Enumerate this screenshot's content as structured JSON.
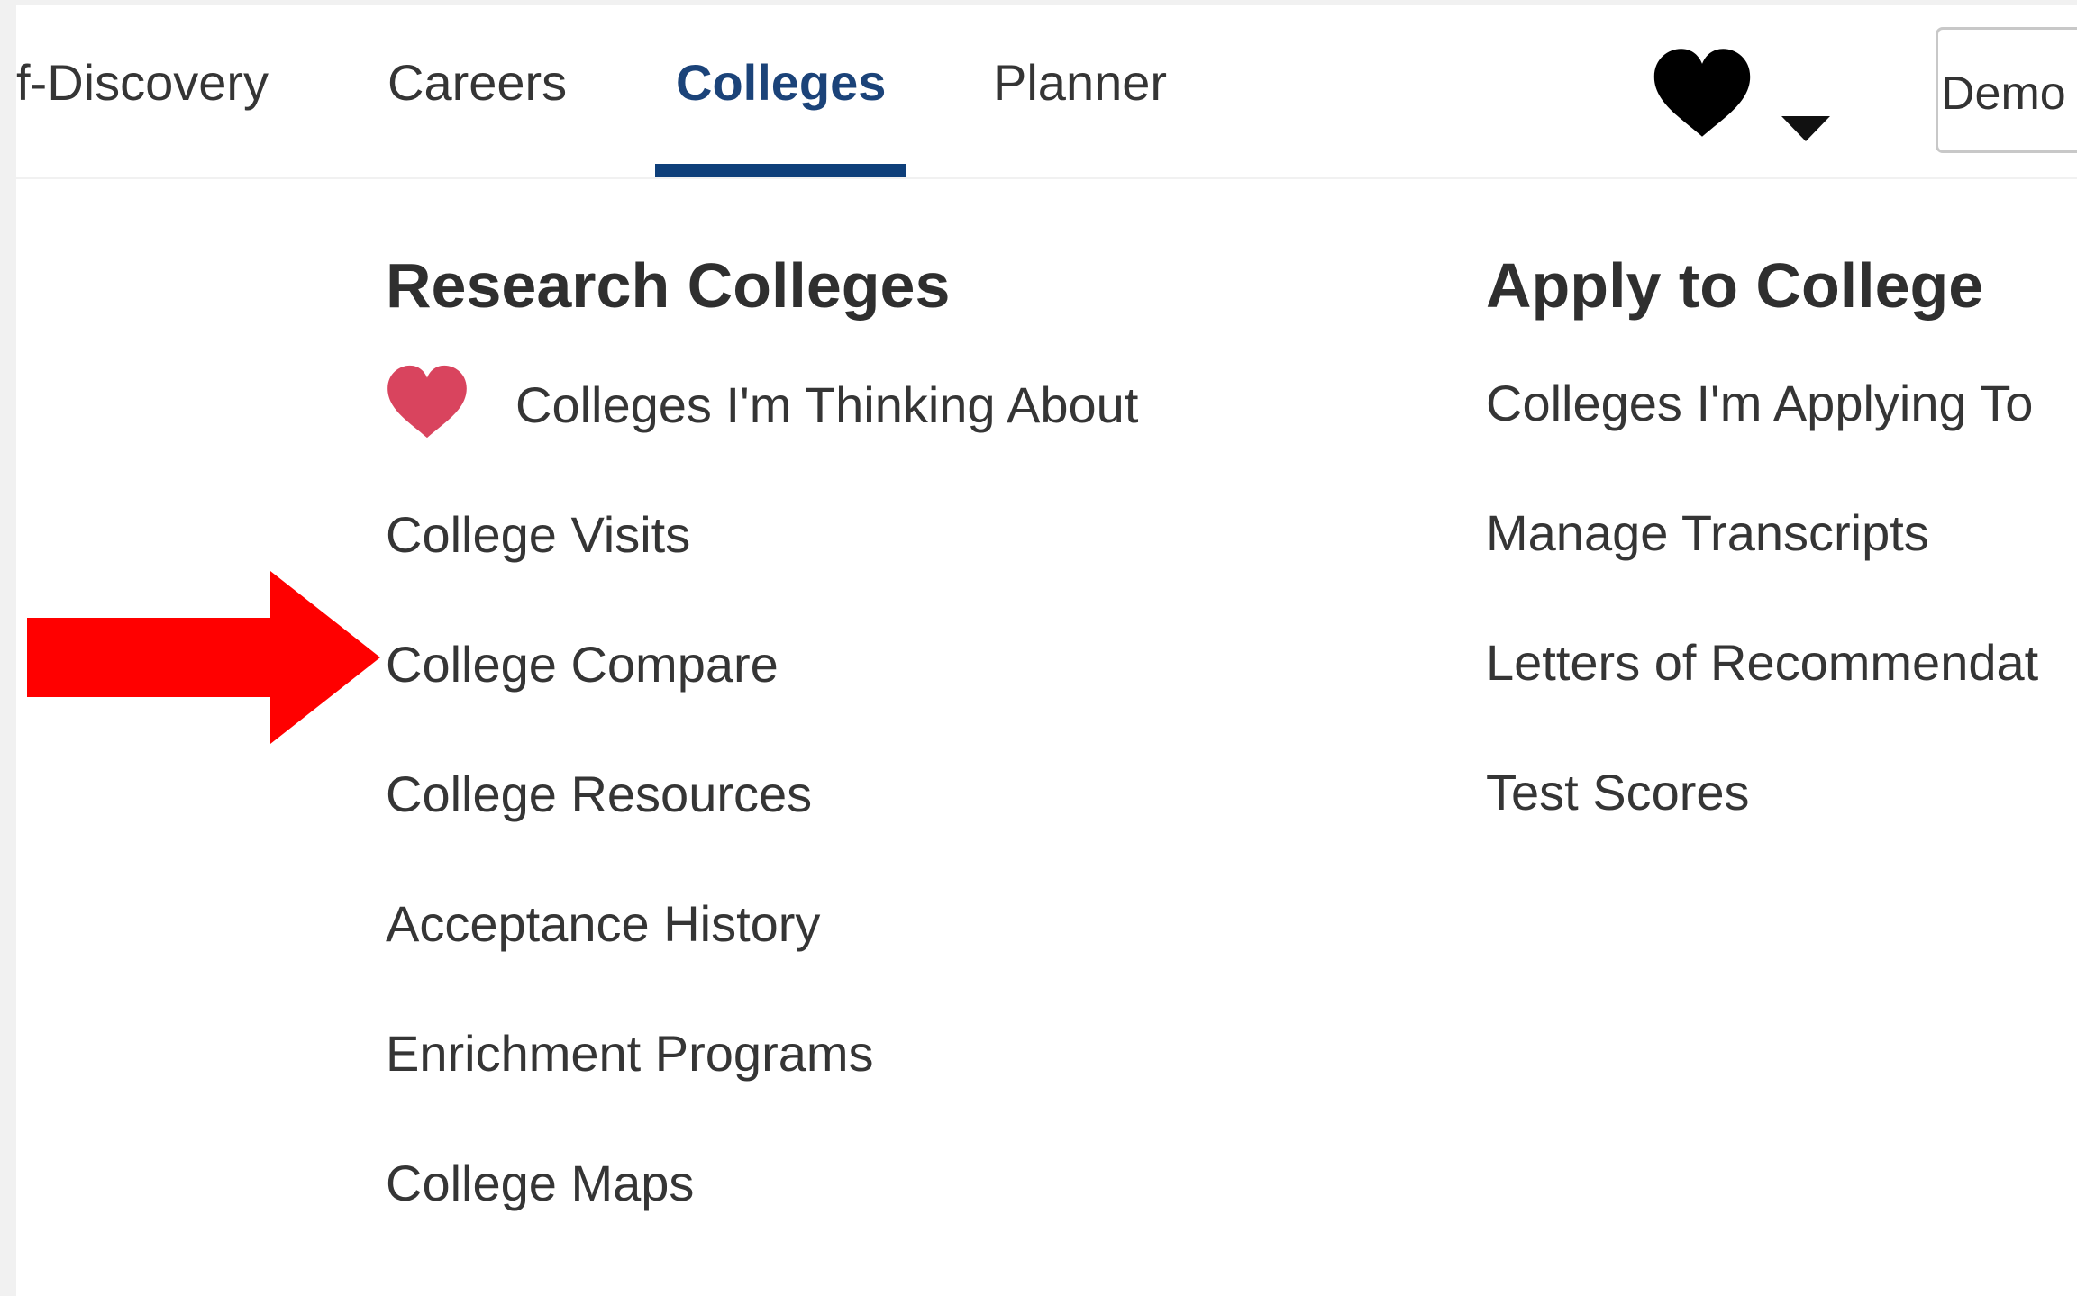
{
  "nav": {
    "tabs": [
      {
        "label": "f-Discovery"
      },
      {
        "label": "Careers"
      },
      {
        "label": "Colleges",
        "active": true
      },
      {
        "label": "Planner"
      }
    ],
    "favorites_icon": "heart-icon",
    "dropdown_icon": "caret-down-icon",
    "user_label": "Demo"
  },
  "research": {
    "heading": "Research Colleges",
    "items": [
      {
        "label": "Colleges I'm Thinking About",
        "icon": "heart-icon"
      },
      {
        "label": "College Visits"
      },
      {
        "label": "College Compare"
      },
      {
        "label": "College Resources"
      },
      {
        "label": "Acceptance History"
      },
      {
        "label": "Enrichment Programs"
      },
      {
        "label": "College Maps"
      }
    ]
  },
  "apply": {
    "heading": "Apply to College",
    "items": [
      {
        "label": "Colleges I'm Applying To"
      },
      {
        "label": "Manage Transcripts"
      },
      {
        "label": "Letters of Recommendat"
      },
      {
        "label": "Test Scores"
      }
    ]
  },
  "annotation": {
    "icon": "red-arrow-icon",
    "target": "College Compare"
  },
  "colors": {
    "active_tab": "#1b4379",
    "tab_indicator": "#0e3f7a",
    "thinking_heart": "#d9445e",
    "arrow": "#ff0000",
    "text": "#353535"
  }
}
